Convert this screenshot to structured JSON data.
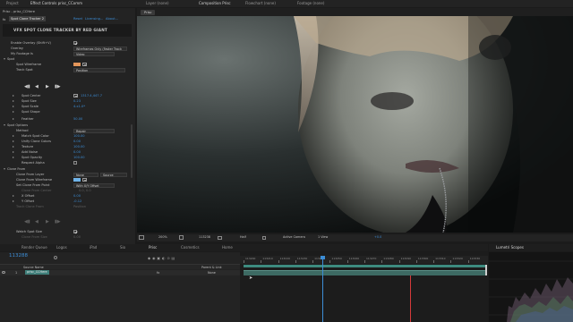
{
  "top_bar": {
    "project_tab": "Project",
    "effect_controls_tab": "Effect Controls prisc_CComm",
    "layer_tab": "Layer (none)",
    "composition_tab": "Composition Prisc",
    "flowchart_tab": "Flowchart (none)",
    "footage_tab": "Footage (none)",
    "comp_chip": "Prisc"
  },
  "effect_controls": {
    "breadcrumb": "Prisc - prisc_CCHere",
    "layer_chip": "Spot Clone Tracker 2",
    "reset_label": "Reset",
    "licensing_label": "Licensing...",
    "about_label": "About...",
    "banner_text": "VFX SPOT CLONE TRACKER BY RED GIANT",
    "enable_overlay_label": "Enable Overlay (Shift+V)",
    "overlay_label": "Overlay",
    "overlay_value": "Wireframes Only (Faster Track",
    "my_footage_label": "My Footage Is",
    "my_footage_value": "Video",
    "spot_label": "Spot",
    "spot_wireframe_label": "Spot Wireframe",
    "track_spot_label": "Track Spot",
    "track_spot_value": "Position",
    "spot_center_label": "Spot Center",
    "spot_center_value": "1317.4,447.7",
    "spot_size_label": "Spot Size",
    "spot_size_value": "0.23",
    "spot_scale_label": "Spot Scale",
    "spot_scale_value": "4.x1.0*",
    "spot_shape_label": "Spot Shape",
    "feather_label": "Feather",
    "feather_value": "50.00",
    "spot_options_label": "Spot Options",
    "method_label": "Method",
    "method_value": "Repair",
    "match_spot_color_label": "Match Spot Color",
    "match_spot_color_value": "100.00",
    "unify_clone_colors_label": "Unify Clone Colors",
    "unify_clone_colors_value": "0.00",
    "texture_label": "Texture",
    "texture_value": "100.00",
    "add_noise_label": "Add Noise",
    "add_noise_value": "0.00",
    "spot_opacity_label": "Spot Opacity",
    "spot_opacity_value": "100.00",
    "respect_alpha_label": "Respect Alpha",
    "clone_from_label": "Clone From",
    "clone_from_layer_label": "Clone From Layer",
    "clone_from_layer_value": "None",
    "source_label": "Source",
    "clone_from_wireframe_label": "Clone From Wireframe",
    "set_clone_from_point_label": "Set Clone From Point",
    "set_clone_from_point_value": "With X/Y Offset",
    "clone_from_center_label": "Clone From Center",
    "clone_from_center_value": "0.0, 0.0",
    "x_offset_label": "X Offset",
    "x_offset_value": "0.00",
    "y_offset_label": "Y Offset",
    "y_offset_value": "-0.12",
    "track_clone_from_label": "Track Clone From",
    "track_clone_from_value": "Position",
    "watch_spot_size_label": "Watch Spot Size",
    "clone_from_size_label": "Clone From Size",
    "clone_from_size_value": "0.00"
  },
  "viewer_controls": {
    "zoom": "200%",
    "timecode": "113238",
    "resolution": "Half",
    "camera": "Active Camera",
    "views": "1 View",
    "exposure": "+0.0"
  },
  "bottom_tabs": {
    "render_queue": "Render Queue",
    "logos": "Logos",
    "ipad": "iPad",
    "sio": "Sio",
    "prisc": "Prisc",
    "cosmetics": "Cosmetics",
    "home": "Home",
    "lumetri": "Lumetri Scopes"
  },
  "timeline": {
    "timecode": "113288",
    "source_name_header": "Source Name",
    "parent_link_header": "Parent & Link",
    "layer_number": "1",
    "layer_name": "prisc_CCHere",
    "parent_value": "None",
    "ruler_labels": [
      "113200",
      "113210",
      "113220",
      "113230",
      "113240",
      "113250",
      "113260",
      "113270",
      "113280",
      "113290",
      "113300",
      "113310",
      "113320",
      "113330"
    ]
  },
  "colors": {
    "accent_blue": "#3c8dd6",
    "swatch_orange": "#e3955a",
    "playhead": "#3c8dd6",
    "work_area_green": "#3d8b7f",
    "layer_bar": "#3d6a63",
    "marker_red": "#d43a3a"
  },
  "icons": [
    "triangle-disclosure-icon",
    "play-icon",
    "stop-icon",
    "step-back-icon",
    "step-forward-icon",
    "checkbox-icon",
    "wireframe-icon",
    "search-icon",
    "camera-icon"
  ]
}
